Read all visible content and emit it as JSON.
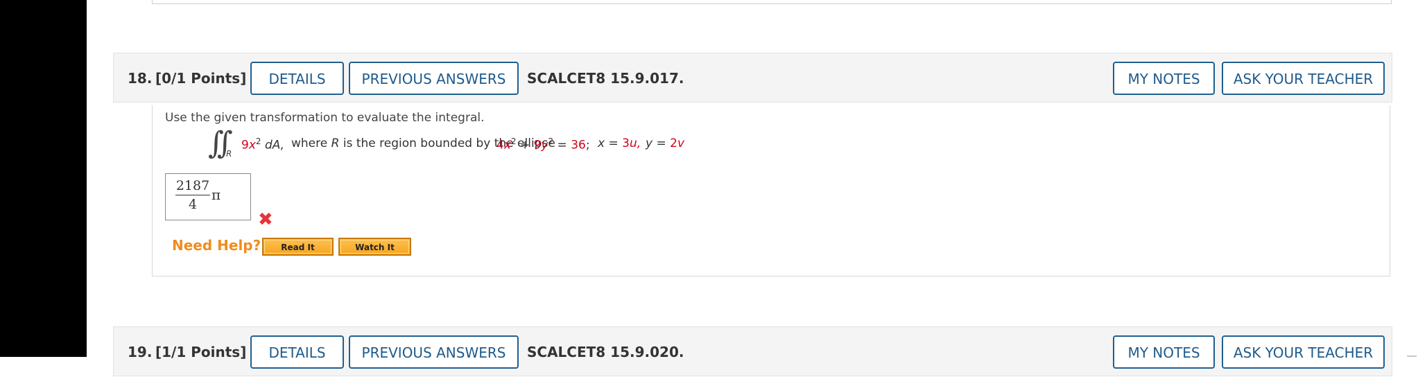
{
  "question18": {
    "number": "18.",
    "points": "[0/1 Points]",
    "details_label": "DETAILS",
    "previous_answers_label": "PREVIOUS ANSWERS",
    "reference": "SCALCET8 15.9.017.",
    "my_notes_label": "MY NOTES",
    "ask_teacher_label": "ASK YOUR TEACHER",
    "instruction": "Use the given transformation to evaluate the integral.",
    "formula": {
      "integral_symbol": "∫∫",
      "region_subscript": "R",
      "integrand_coef": "9",
      "integrand_var": "x",
      "integrand_exp": "2",
      "differential": "dA,",
      "where_text": "where",
      "region_var": "R",
      "region_text": "is the region bounded by the ellipse",
      "ellipse_coef1": "4",
      "ellipse_var1": "x",
      "ellipse_exp1": "2",
      "plus": "+",
      "ellipse_coef2": "9",
      "ellipse_var2": "y",
      "ellipse_exp2": "2",
      "equals": "=",
      "ellipse_rhs": "36",
      "semicolon": ";",
      "x_var": "x",
      "x_eq": "=",
      "x_coef": "3",
      "x_param": "u,",
      "y_var": "y",
      "y_eq": "=",
      "y_coef": "2",
      "y_param": "v"
    },
    "answer": {
      "numerator": "2187",
      "denominator": "4",
      "pi": "π"
    },
    "status": "incorrect",
    "status_icon": "✖",
    "need_help_label": "Need Help?",
    "read_it_label": "Read It",
    "watch_it_label": "Watch It"
  },
  "question19": {
    "number": "19.",
    "points": "[1/1 Points]",
    "details_label": "DETAILS",
    "previous_answers_label": "PREVIOUS ANSWERS",
    "reference": "SCALCET8 15.9.020.",
    "my_notes_label": "MY NOTES",
    "ask_teacher_label": "ASK YOUR TEACHER"
  },
  "colors": {
    "button_border": "#1f5f8f",
    "button_text": "#1f5a8a",
    "highlight_red": "#d0021b",
    "need_help_orange": "#f08c1e",
    "wrong_mark": "#e8333a"
  }
}
